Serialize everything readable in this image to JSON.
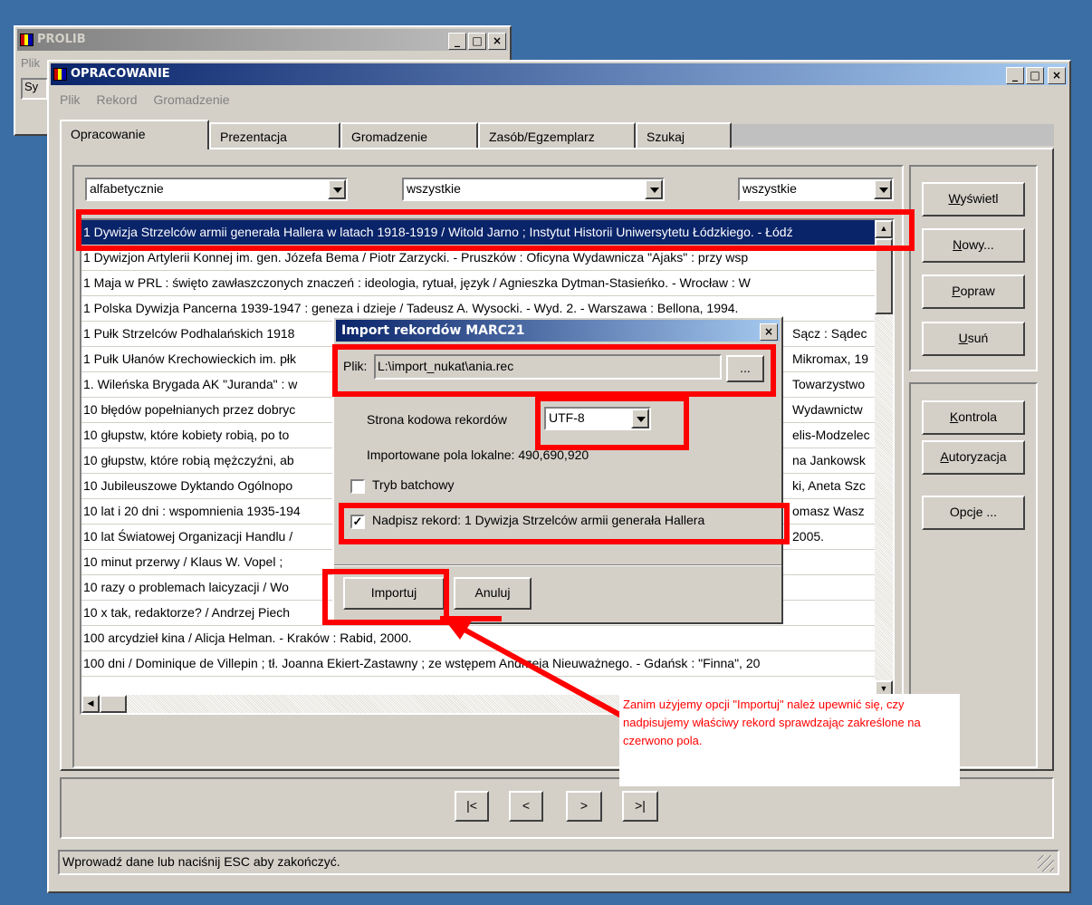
{
  "prolib": {
    "title": "PROLIB",
    "menu_partial": "Plik",
    "field_partial": "Sy"
  },
  "main": {
    "title": "OPRACOWANIE",
    "menu": [
      "Plik",
      "Rekord",
      "Gromadzenie"
    ],
    "tabs": [
      "Opracowanie",
      "Prezentacja",
      "Gromadzenie",
      "Zasób/Egzemplarz",
      "Szukaj"
    ],
    "active_tab": 0,
    "filters": {
      "sort": "alfabetycznie",
      "filter2": "wszystkie",
      "filter3": "wszystkie"
    },
    "records": [
      "1 Dywizja Strzelców armii generała Hallera w latach 1918-1919 / Witold Jarno ; Instytut Historii Uniwersytetu Łódzkiego. - Łódź",
      "1 Dywizjon Artylerii Konnej im. gen. Józefa Bema / Piotr Zarzycki. - Pruszków : Oficyna Wydawnicza \"Ajaks\" : przy wsp",
      "1 Maja w PRL : święto zawłaszczonych znaczeń : ideologia, rytuał, język / Agnieszka Dytman-Stasieńko. - Wrocław : W",
      "1 Polska Dywizja Pancerna 1939-1947 : geneza i dzieje / Tadeusz A. Wysocki. - Wyd. 2. - Warszawa : Bellona, 1994.",
      "1 Pułk Strzelców Podhalańskich 1918",
      "1 Pułk Ułanów Krechowieckich im. płk",
      "1. Wileńska Brygada AK \"Juranda\" : w",
      "10 błędów popełnianych przez dobryc",
      "10 głupstw, które kobiety robią, po to",
      "10 głupstw, które robią mężczyźni, ab",
      "10 Jubileuszowe Dyktando Ogólnopo",
      "10 lat i 20 dni : wspomnienia 1935-194",
      "10 lat Światowej Organizacji Handlu /",
      "10 minut przerwy / Klaus W. Vopel ;",
      "10 razy o problemach laicyzacji / Wo",
      "10 x tak, redaktorze? / Andrzej Piech",
      "100 arcydzieł kina / Alicja Helman. - Kraków : Rabid, 2000.",
      "100 dni / Dominique de Villepin ; tł. Joanna Ekiert-Zastawny ; ze wstępem Andrzeja Nieuważnego. - Gdańsk : \"Finna\", 20"
    ],
    "records_right": [
      "",
      "",
      "",
      "",
      "Sącz : Sądec",
      "Mikromax, 19",
      "Towarzystwo",
      "Wydawnictw",
      "elis-Modzelec",
      "na Jankowsk",
      "ki, Aneta Szc",
      "omasz Wasz",
      "2005.",
      "",
      "",
      "",
      "",
      ""
    ],
    "side_buttons": [
      "Wyświetl",
      "Nowy...",
      "Popraw",
      "Usuń",
      "Kontrola",
      "Autoryzacja",
      "Opcje ..."
    ],
    "nav_buttons": [
      "|<",
      "<",
      ">",
      ">|"
    ],
    "status": "Wprowadź dane lub naciśnij ESC aby zakończyć."
  },
  "dialog": {
    "title": "Import rekordów MARC21",
    "file_label": "Plik:",
    "file_value": "L:\\import_nukat\\ania.rec",
    "browse_label": "...",
    "codepage_label": "Strona kodowa rekordów",
    "codepage_value": "UTF-8",
    "local_fields_label": "Importowane pola lokalne:",
    "local_fields_value": "490,690,920",
    "batch_label": "Tryb batchowy",
    "overwrite_label": "Nadpisz rekord:",
    "overwrite_value": "1 Dywizja Strzelców armii generała Hallera",
    "import_button": "Importuj",
    "cancel_button": "Anuluj"
  },
  "annotation": "Zanim użyjemy opcji \"Importuj\" należ upewnić się, czy nadpisujemy właściwy rekord sprawdzając zakreślone na czerwono pola.",
  "colors": {
    "desktop": "#3a6ea5",
    "title_active": "#0a246a",
    "selection": "#0a246a",
    "highlight": "#ff0000"
  }
}
